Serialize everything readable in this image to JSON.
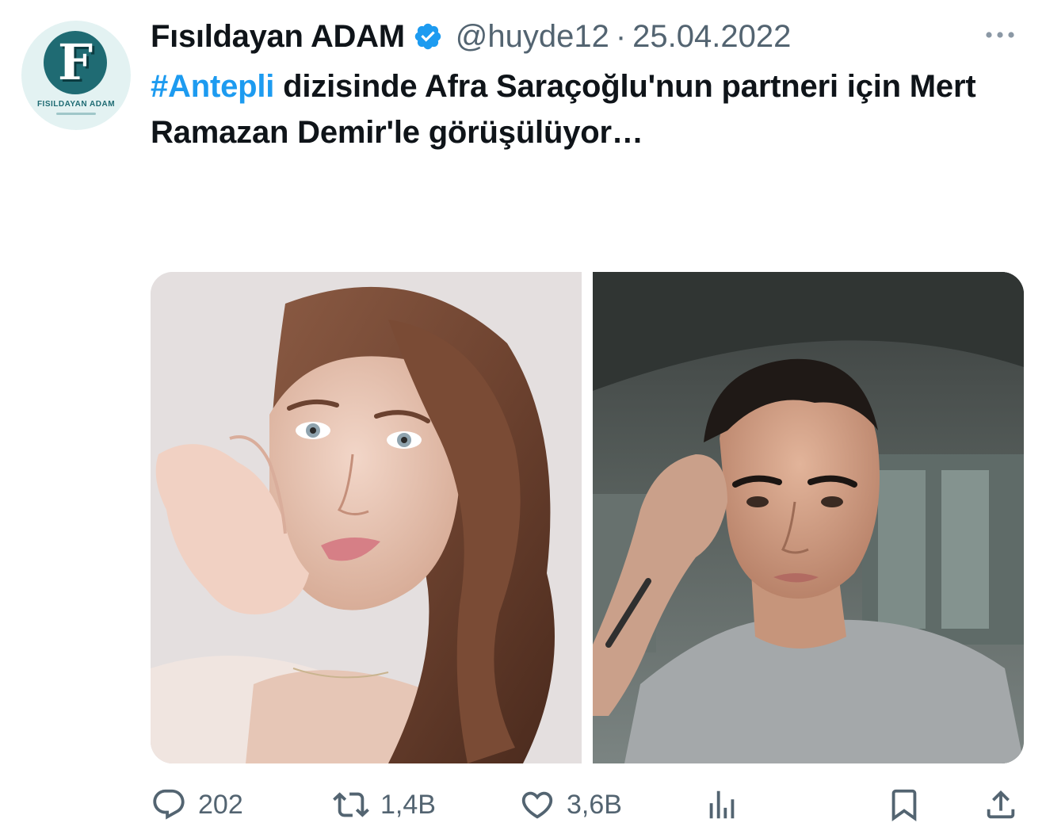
{
  "tweet": {
    "author": {
      "display_name": "Fısıldayan ADAM",
      "handle": "@huyde12",
      "verified": true,
      "avatar_logo_letter": "F",
      "avatar_logo_text": "FISILDAYAN ADAM"
    },
    "separator": "·",
    "date": "25.04.2022",
    "text": {
      "hashtag": "#Antepli",
      "body": " dizisinde Afra Saraçoğlu'nun partneri için Mert Ramazan Demir'le görüşülüyor…"
    },
    "media": {
      "count": 2,
      "images": [
        "photo-woman-portrait",
        "photo-man-selfie"
      ]
    },
    "actions": {
      "replies": "202",
      "retweets": "1,4B",
      "likes": "3,6B"
    },
    "colors": {
      "accent": "#1d9bf0",
      "text": "#0f1419",
      "secondary": "#536471"
    },
    "icons": [
      "verified-badge-icon",
      "more-icon",
      "reply-icon",
      "retweet-icon",
      "like-icon",
      "views-icon",
      "bookmark-icon",
      "share-icon"
    ]
  }
}
